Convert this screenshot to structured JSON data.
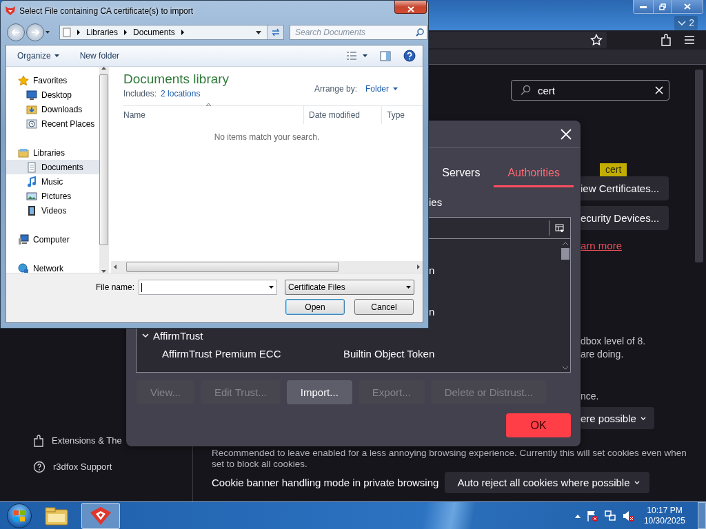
{
  "browser": {
    "tab_count": "2",
    "search": {
      "value": "cert"
    },
    "partial": {
      "certificates_button": "iew Certificates...",
      "tooltip": "cert",
      "devices_button": "ecurity Devices...",
      "learn_more": "arn more",
      "sandbox_lines": [
        "dbox level of 8.",
        "are doing."
      ],
      "note_end": "nce.",
      "dropdown": "ere possible"
    },
    "cookie_note": "Recommended to leave enabled for a less annoying browsing experience. Currently this will set cookies even when set to block all cookies.",
    "private_cookie": {
      "label": "Cookie banner handling mode in private browsing",
      "value": "Auto reject all cookies where possible"
    },
    "sidebar": [
      {
        "label": "Extensions & The",
        "kind": "extensions"
      },
      {
        "label": "r3dfox Support",
        "kind": "support"
      }
    ]
  },
  "cert_manager": {
    "tabs": [
      {
        "label": "Servers",
        "selected": false
      },
      {
        "label": "Authorities",
        "selected": true
      }
    ],
    "heading": "ies",
    "rows": [
      {
        "kind": "fragment",
        "text": "n"
      },
      {
        "kind": "fragment",
        "text": "n"
      },
      {
        "kind": "group",
        "label": "AffirmTrust",
        "expanded": true
      },
      {
        "kind": "certificate",
        "name": "AffirmTrust Premium ECC",
        "token": "Builtin Object Token"
      }
    ],
    "buttons": [
      {
        "label": "View...",
        "disabled": true,
        "hovered": false
      },
      {
        "label": "Edit Trust...",
        "disabled": true,
        "hovered": false
      },
      {
        "label": "Import...",
        "disabled": false,
        "hovered": true
      },
      {
        "label": "Export...",
        "disabled": true,
        "hovered": false
      },
      {
        "label": "Delete or Distrust...",
        "disabled": true,
        "hovered": false
      }
    ],
    "ok": "OK"
  },
  "file_dialog": {
    "title": "Select File containing CA certificate(s) to import",
    "breadcrumb": [
      "Libraries",
      "Documents"
    ],
    "search": {
      "placeholder": "Search Documents"
    },
    "toolbar": [
      {
        "label": "Organize",
        "kind": "menu"
      },
      {
        "label": "New folder",
        "kind": "button"
      }
    ],
    "nav": [
      {
        "label": "Favorites",
        "kind": "favorites",
        "selected": false,
        "children": [
          {
            "label": "Desktop",
            "kind": "desktop",
            "selected": false
          },
          {
            "label": "Downloads",
            "kind": "downloads",
            "selected": false
          },
          {
            "label": "Recent Places",
            "kind": "recent",
            "selected": false
          }
        ]
      },
      {
        "label": "Libraries",
        "kind": "libraries",
        "selected": false,
        "children": [
          {
            "label": "Documents",
            "kind": "documents",
            "selected": true
          },
          {
            "label": "Music",
            "kind": "music",
            "selected": false
          },
          {
            "label": "Pictures",
            "kind": "pictures",
            "selected": false
          },
          {
            "label": "Videos",
            "kind": "videos",
            "selected": false
          }
        ]
      },
      {
        "label": "Computer",
        "kind": "computer",
        "selected": false
      },
      {
        "label": "Network",
        "kind": "network",
        "selected": false
      }
    ],
    "library_title": "Documents library",
    "includes_label": "Includes:",
    "includes_link": "2 locations",
    "arrange_label": "Arrange by:",
    "arrange_value": "Folder",
    "columns": [
      "Name",
      "Date modified",
      "Type"
    ],
    "empty_message": "No items match your search.",
    "file_name_label": "File name:",
    "file_type": "Certificate Files",
    "buttons": [
      {
        "label": "Open",
        "default": true
      },
      {
        "label": "Cancel",
        "default": false
      }
    ]
  },
  "taskbar": {
    "apps": [
      {
        "kind": "explorer",
        "active": false
      },
      {
        "kind": "browser",
        "active": true
      }
    ],
    "time": "10:17 PM",
    "date": "10/30/2025"
  }
}
